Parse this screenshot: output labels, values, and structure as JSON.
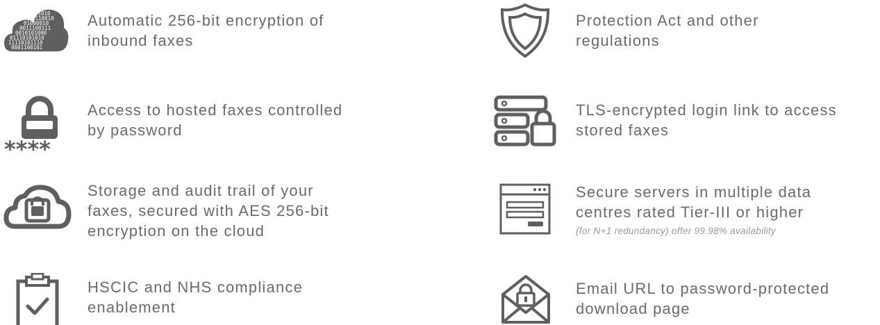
{
  "colors": {
    "icon": "#5f5f5f",
    "text": "#6b6b6b",
    "note": "#9a9a9a",
    "background": "#ffffff"
  },
  "left_features": [
    {
      "icon": "binary-cloud-icon",
      "lines": [
        "Automatic 256-bit encryption of",
        "inbound faxes"
      ]
    },
    {
      "icon": "padlock-password-icon",
      "lines": [
        "Access to hosted faxes controlled",
        "by password"
      ]
    },
    {
      "icon": "cloud-lock-icon",
      "lines": [
        "Storage and audit trail of your",
        "faxes, secured with AES 256-bit",
        "encryption on the cloud"
      ]
    },
    {
      "icon": "clipboard-check-icon",
      "lines": [
        "HSCIC and NHS compliance",
        "enablement"
      ]
    }
  ],
  "right_features": [
    {
      "icon": "shield-icon",
      "lines": [
        "Protection Act and other",
        "regulations"
      ]
    },
    {
      "icon": "server-lock-icon",
      "lines": [
        "TLS-encrypted login link to access",
        "stored faxes"
      ]
    },
    {
      "icon": "browser-window-icon",
      "lines": [
        "Secure servers in multiple data",
        "centres rated Tier-III or higher"
      ],
      "note": "(for N+1 redundancy) offer 99.98% availability"
    },
    {
      "icon": "envelope-lock-icon",
      "lines": [
        "Email URL to password-protected",
        "download page"
      ]
    }
  ],
  "password_mask": "****",
  "binary_rows": [
    "01010",
    "1110010",
    "01000010",
    "0011100111",
    "0010101000",
    "01110101010",
    "11110101110",
    "0001100101"
  ]
}
